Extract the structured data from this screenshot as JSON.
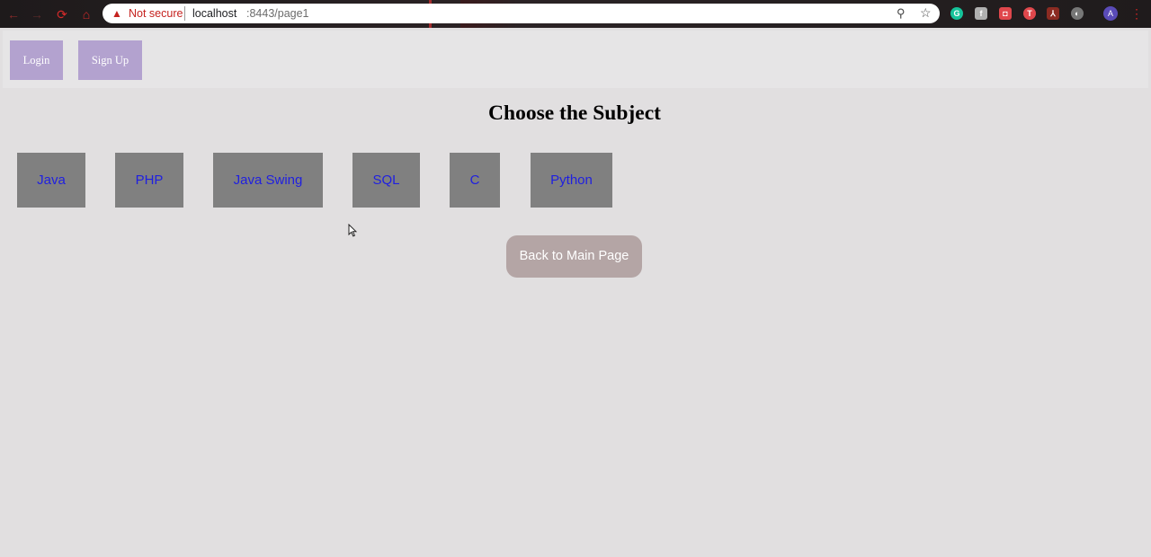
{
  "browser": {
    "security_label": "Not secure",
    "url_host": "localhost",
    "url_rest": ":8443/page1",
    "avatar_letter": "A",
    "extension_icons": [
      "grammarly-icon",
      "facebook-icon",
      "shield-icon",
      "t-icon",
      "pdf-icon",
      "gray-extension-icon"
    ]
  },
  "header": {
    "login_label": "Login",
    "signup_label": "Sign Up"
  },
  "main": {
    "title": "Choose the Subject",
    "subjects": [
      "Java",
      "PHP",
      "Java Swing",
      "SQL",
      "C",
      "Python"
    ],
    "back_label": "Back to Main Page"
  },
  "colors": {
    "background": "#e1dfe0",
    "auth_button": "#b3a2cf",
    "subject_tile": "#808080",
    "subject_text": "#1f1fe0",
    "back_button": "#b4a5a5"
  }
}
